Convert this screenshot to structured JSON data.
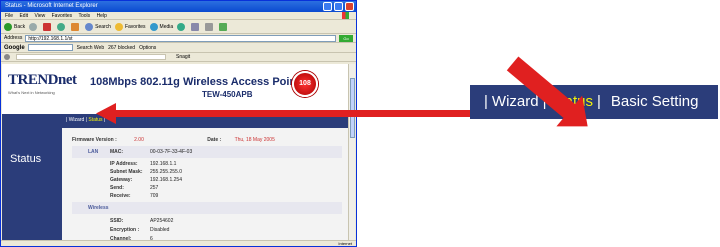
{
  "browser": {
    "title": "Status - Microsoft Internet Explorer",
    "menu": [
      "File",
      "Edit",
      "View",
      "Favorites",
      "Tools",
      "Help"
    ],
    "toolbar": {
      "back": "Back",
      "search": "Search",
      "favorites": "Favorites",
      "media": "Media"
    },
    "address": {
      "label": "Address",
      "value": "http://192.168.1.1/st",
      "go": "Go"
    },
    "google": {
      "logo": "Google",
      "search_web": "Search Web",
      "popups": "267 blocked",
      "options": "Options"
    },
    "links_label": "Snagit",
    "status_zone": "Internet"
  },
  "router": {
    "logo": "TRENDnet",
    "logo_sub": "What's Next in Networking",
    "title": "108Mbps 802.11g Wireless Access Point",
    "model": "TEW-450APB",
    "badge": "108",
    "nav": {
      "wizard": "Wizard",
      "status": "Status"
    },
    "side_label": "Status",
    "firmware": {
      "label": "Firmware Version :",
      "value": "2.00",
      "date_label": "Date :",
      "date_value": "Thu, 18 May 2005"
    },
    "lan": {
      "section": "LAN",
      "mac_label": "MAC:",
      "mac": "00-03-7F-33-4F-03",
      "ip_label": "IP Address:",
      "ip": "192.168.1.1",
      "mask_label": "Subnet Mask:",
      "mask": "255.255.255.0",
      "gw_label": "Gateway:",
      "gw": "192.168.1.254",
      "send_label": "Send:",
      "send": "257",
      "recv_label": "Receive:",
      "recv": "709"
    },
    "wireless": {
      "section": "Wireless",
      "ssid_label": "SSID:",
      "ssid": "AP254602",
      "enc_label": "Encryption :",
      "enc": "Disabled",
      "chan_label": "Channel:",
      "chan": "6"
    }
  },
  "callout": {
    "wizard": "Wizard",
    "status": "Status",
    "basic": "Basic Setting"
  },
  "colors": {
    "nav_blue": "#2b3d7a",
    "highlight_yellow": "#f2f20a",
    "arrow_red": "#e02020"
  }
}
